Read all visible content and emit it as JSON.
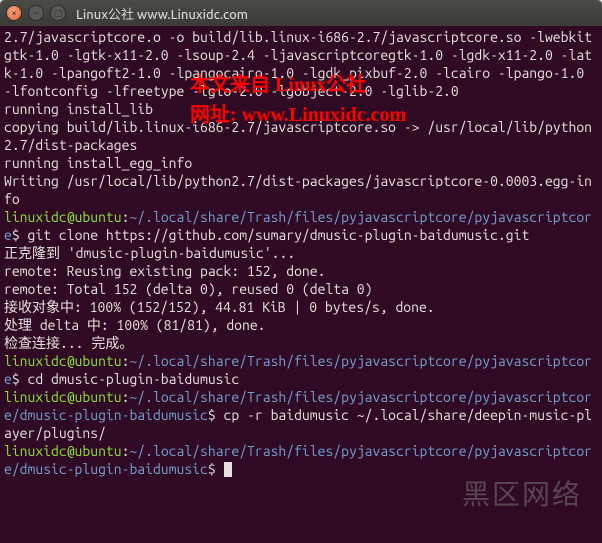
{
  "window": {
    "title": "Linux公社 www.Linuxidc.com"
  },
  "watermark": {
    "line1": "本文来自 Linux公社",
    "line2": "网址: www.Linuxidc.com",
    "corner": "黑区网络"
  },
  "terminal": {
    "lines": [
      {
        "t": "2.7/javascriptcore.o -o build/lib.linux-i686-2.7/javascriptcore.so -lwebkitgtk-1.0 -lgtk-x11-2.0 -lsoup-2.4 -ljavascriptcoregtk-1.0 -lgdk-x11-2.0 -latk-1.0 -lpangoft2-1.0 -lpangocairo-1.0 -lgdk_pixbuf-2.0 -lcairo -lpango-1.0 -lfontconfig -lfreetype -lgio-2.0 -lgobject-2.0 -lglib-2.0"
      },
      {
        "t": "running install_lib"
      },
      {
        "t": "copying build/lib.linux-i686-2.7/javascriptcore.so -> /usr/local/lib/python2.7/dist-packages"
      },
      {
        "t": "running install_egg_info"
      },
      {
        "t": "Writing /usr/local/lib/python2.7/dist-packages/javascriptcore-0.0003.egg-info"
      },
      {
        "prompt": {
          "user": "linuxidc@ubuntu",
          "path": "~/.local/share/Trash/files/pyjavascriptcore/pyjavascriptcore",
          "cmd": "git clone https://github.com/sumary/dmusic-plugin-baidumusic.git"
        }
      },
      {
        "t": "正克隆到 'dmusic-plugin-baidumusic'..."
      },
      {
        "t": "remote: Reusing existing pack: 152, done."
      },
      {
        "t": "remote: Total 152 (delta 0), reused 0 (delta 0)"
      },
      {
        "t": "接收对象中: 100% (152/152), 44.81 KiB | 0 bytes/s, done."
      },
      {
        "t": "处理 delta 中: 100% (81/81), done."
      },
      {
        "t": "检查连接... 完成。"
      },
      {
        "prompt": {
          "user": "linuxidc@ubuntu",
          "path": "~/.local/share/Trash/files/pyjavascriptcore/pyjavascriptcore",
          "cmd": "cd dmusic-plugin-baidumusic"
        }
      },
      {
        "prompt": {
          "user": "linuxidc@ubuntu",
          "path": "~/.local/share/Trash/files/pyjavascriptcore/pyjavascriptcore/dmusic-plugin-baidumusic",
          "cmd": "cp -r baidumusic ~/.local/share/deepin-music-player/plugins/"
        }
      },
      {
        "prompt": {
          "user": "linuxidc@ubuntu",
          "path": "~/.local/share/Trash/files/pyjavascriptcore/pyjavascriptcore/dmusic-plugin-baidumusic",
          "cmd": "",
          "cursor": true
        }
      }
    ]
  }
}
